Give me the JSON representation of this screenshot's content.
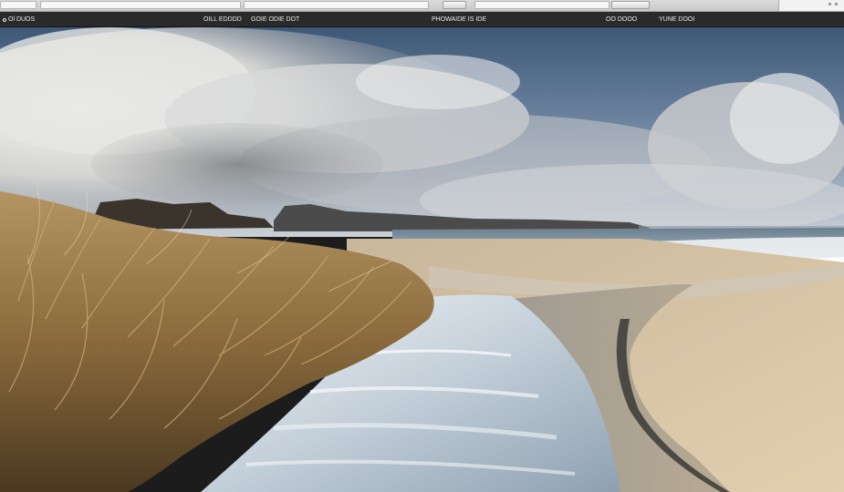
{
  "toolbar": {
    "address_text": "",
    "go_label": "",
    "zoom_label": "",
    "panel_label": ""
  },
  "menubar": {
    "items": [
      {
        "label": "Ol DUOS"
      },
      {
        "label": "OILL EDDDD"
      },
      {
        "label": "GOIE ODIE DOT"
      },
      {
        "label": "PHOWAIDE IS IDE"
      },
      {
        "label": "OO DOOO"
      },
      {
        "label": "YUNE DOOI"
      }
    ]
  },
  "canvas": {
    "description_icon": "photo-icon"
  },
  "colors": {
    "toolbar_bg": "#d3d3d3",
    "menubar_bg": "#2a2a2a",
    "sky_top": "#3f5a78",
    "sand": "#d6c4a6",
    "grass": "#8a6a3c",
    "water": "#dfe8ef"
  }
}
